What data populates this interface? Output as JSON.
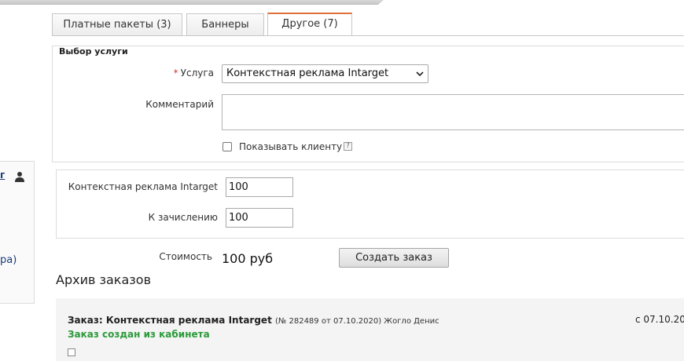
{
  "tabs": [
    {
      "label": "Платные пакеты (3)"
    },
    {
      "label": "Баннеры"
    },
    {
      "label": "Другое (7)"
    }
  ],
  "service_section": {
    "legend": "Выбор услуги",
    "service_label": "Услуга",
    "service_value": "Контекстная реклама Intarget",
    "comment_label": "Комментарий",
    "show_client_label": "Показывать клиенту",
    "help_glyph": "?"
  },
  "amounts": {
    "service_label": "Контекстная реклама Intarget",
    "service_value": "100",
    "credit_label": "К зачислению",
    "credit_value": "100"
  },
  "cost": {
    "label": "Стоимость",
    "value": "100 руб",
    "create_button": "Создать заказ"
  },
  "archive": {
    "title": "Архив заказов",
    "order_title": "Заказ: Контекстная реклама Intarget",
    "order_meta": "(№ 282489 от 07.10.2020) Жогло Денис",
    "order_date": "с 07.10.20",
    "order_status": "Заказ создан из кабинета"
  },
  "side": {
    "link_text": "г",
    "link2_text": "ра)"
  },
  "colors": {
    "accent_tab": "#e0703a",
    "status_green": "#2c9a3a",
    "required": "#e03a2a"
  }
}
